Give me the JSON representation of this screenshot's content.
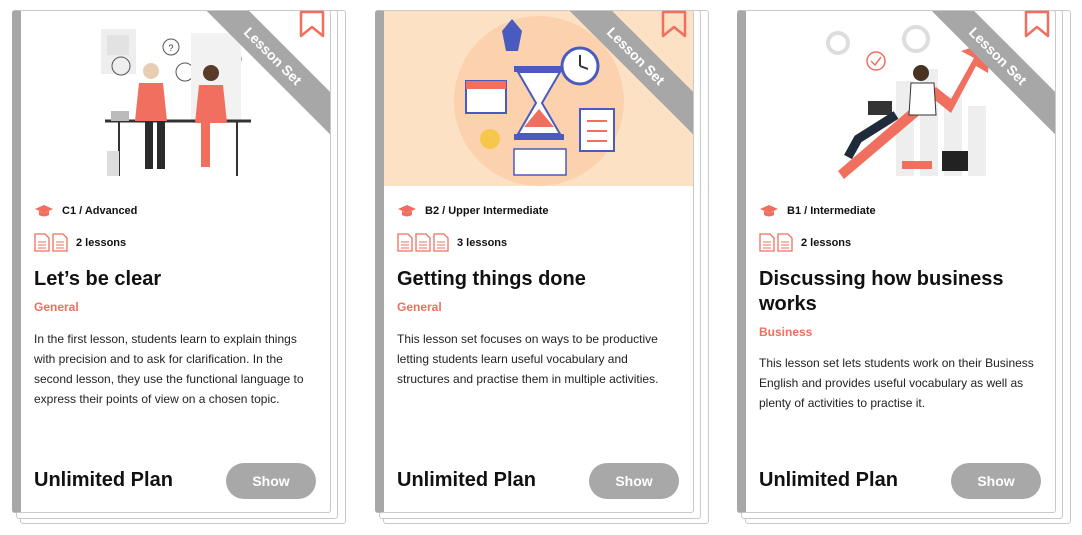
{
  "cards": [
    {
      "ribbon": "Lesson Set",
      "level": "C1 / Advanced",
      "lessons": "2 lessons",
      "title": "Let’s be clear",
      "category": "General",
      "description": "In the first lesson, students learn to explain things with precision and to ask for clarification. In the second lesson, they use the functional language to express their points of view on a chosen topic.",
      "plan": "Unlimited Plan",
      "button": "Show"
    },
    {
      "ribbon": "Lesson Set",
      "level": "B2 / Upper Intermediate",
      "lessons": "3 lessons",
      "title": "Getting things done",
      "category": "General",
      "description": "This lesson set focuses on ways to be productive letting students learn useful vocabulary and structures and practise them in multiple activities.",
      "plan": "Unlimited Plan",
      "button": "Show"
    },
    {
      "ribbon": "Lesson Set",
      "level": "B1 / Intermediate",
      "lessons": "2 lessons",
      "title": "Discussing how business works",
      "category": "Business",
      "description": "This lesson set lets students work on their Business English and provides useful vocabulary as well as plenty of activities to practise it.",
      "plan": "Unlimited Plan",
      "button": "Show"
    }
  ],
  "colors": {
    "accent": "#f06f5e",
    "ribbon": "#a7a7a7",
    "button": "#a8a8a8"
  }
}
